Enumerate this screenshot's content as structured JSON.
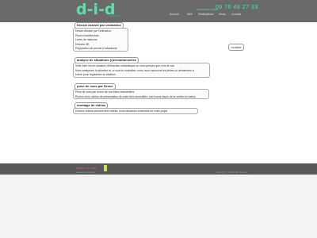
{
  "header": {
    "logo": "d-i-d",
    "logo_sub": "ateliers",
    "tagline": "contactez-nous",
    "phone": "06 70 48 27 33",
    "nav": [
      {
        "label": "Accueil"
      },
      {
        "label": "Défi"
      },
      {
        "label": "Réalisations"
      },
      {
        "label": "Devis"
      },
      {
        "label": "Contact"
      }
    ]
  },
  "main": {
    "contact_button": "contact",
    "sections": [
      {
        "title": "Dessin assisté par ordinateur",
        "lines": [
          "Dessin Assisté par Ordinateur.",
          "Plans d'architecture.",
          "Levés de maisons.",
          "Dessins 3D.",
          "Préparation de permis d'urbanisme"
        ]
      },
      {
        "title": "analyse de situations (r)évolutionnelles",
        "lines": [
          "Votre bien est en situation d'infraction urbanistique ou vous pensez que c'est le cas.",
          "Nous analysons la situation et, si vous le souhaitez, nous vous exposons les pistes ou démarches à",
          "suivre pour régulariser la situation."
        ]
      },
      {
        "title": "prise de vues par Drone",
        "lines": [
          "Prise de vues par drone de vos biens immobiliers.",
          "Photos et/ou vidéos de présentation de votre bien immobilier, une bonne façon de la mettre en valeur."
        ]
      },
      {
        "title": "montage de vidéos",
        "lines": [
          "Donnez vidéos peuvent être créées, nous discutons ensemble de votre projet"
        ]
      }
    ]
  },
  "footer": {
    "left": "ateliers d-i-d sprl",
    "sub": "www.ateliers-did.be",
    "right": "Copyright © Tous droits réservés"
  },
  "colors": {
    "header_bg": "#6a6a6a",
    "accent": "#53e5a9",
    "footer_bg": "#585858",
    "footer_pink": "#e85c8a"
  }
}
